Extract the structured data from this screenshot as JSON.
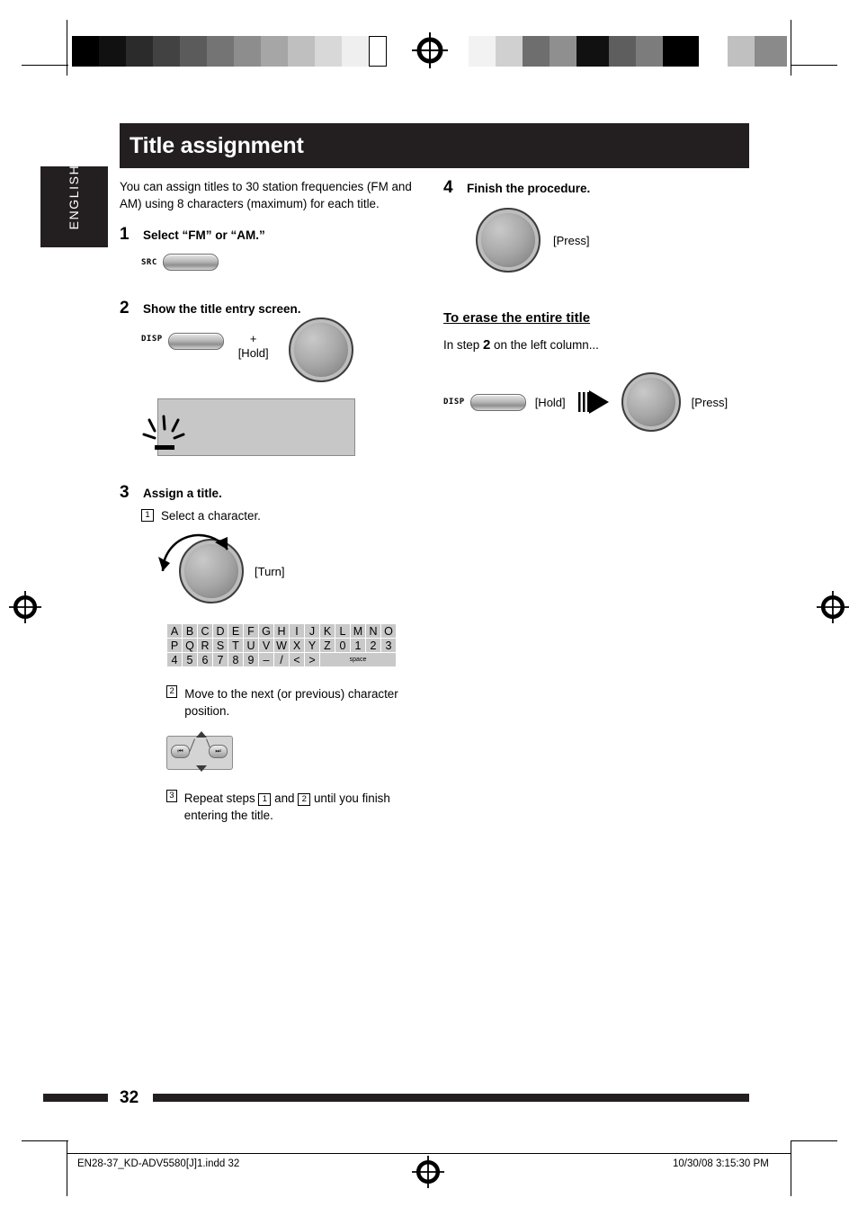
{
  "page": {
    "title": "Title assignment",
    "language_tab": "ENGLISH",
    "intro": "You can assign titles to 30 station frequencies (FM and AM) using 8 characters (maximum) for each title.",
    "page_number": "32",
    "footer_file": "EN28-37_KD-ADV5580[J]1.indd   32",
    "footer_date": "10/30/08   3:15:30 PM"
  },
  "left_column": {
    "steps": [
      {
        "num": "1",
        "heading": "Select “FM” or “AM.”",
        "button_label": "SRC"
      },
      {
        "num": "2",
        "heading": "Show the title entry screen.",
        "button_label": "DISP",
        "plus": "+",
        "hold": "[Hold]"
      },
      {
        "num": "3",
        "heading": "Assign a title.",
        "substeps": [
          {
            "num": "1",
            "text": "Select a character."
          },
          {
            "num": "2",
            "text": "Move to the next (or previous) character position."
          },
          {
            "num": "3",
            "text": "Repeat steps ① and ② until you finish entering the title."
          }
        ],
        "turn_label": "[Turn]",
        "repeat_prefix": "Repeat steps",
        "repeat_mid": "and",
        "repeat_suffix": "until you finish entering the title.",
        "repeat_n1": "1",
        "repeat_n2": "2"
      }
    ],
    "character_table": {
      "rows": [
        [
          "A",
          "B",
          "C",
          "D",
          "E",
          "F",
          "G",
          "H",
          "I",
          "J",
          "K",
          "L",
          "M",
          "N",
          "O"
        ],
        [
          "P",
          "Q",
          "R",
          "S",
          "T",
          "U",
          "V",
          "W",
          "X",
          "Y",
          "Z",
          "0",
          "1",
          "2",
          "3"
        ],
        [
          "4",
          "5",
          "6",
          "7",
          "8",
          "9",
          "–",
          "/",
          "<",
          ">",
          "space"
        ]
      ]
    }
  },
  "right_column": {
    "step4": {
      "num": "4",
      "heading": "Finish the procedure.",
      "press": "[Press]"
    },
    "erase": {
      "heading": "To erase the entire title",
      "line_pre": "In step",
      "line_num": "2",
      "line_post": "on the left column...",
      "button_label": "DISP",
      "hold": "[Hold]",
      "press": "[Press]"
    }
  },
  "colors": {
    "band": "#231f20",
    "screen": "#c7c7c7",
    "key": "#c9c9c9"
  }
}
